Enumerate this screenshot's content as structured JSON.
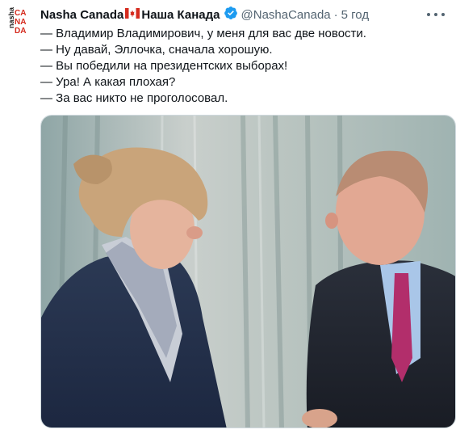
{
  "tweet": {
    "author": {
      "display_name": "Nasha Canada",
      "display_name_2": "Наша Канада",
      "handle": "@NashaCanada",
      "time": "5 год",
      "avatar_icon": "nasha-canada-logo",
      "flag_icon": "canada-flag-icon",
      "verified_icon": "verified-badge-icon"
    },
    "lines": [
      "— Владимир Владимирович, у меня для вас две новости.",
      "— Ну давай, Эллочка, сначала хорошую.",
      "— Вы победили на президентских выборах!",
      "— Ура! А какая плохая?",
      "— За вас никто не проголосовал."
    ],
    "separator": "·",
    "more_icon": "more-options-icon",
    "media": {
      "description_icon": "photo"
    },
    "colors": {
      "verified": "#1d9bf0",
      "secondary_text": "#536471",
      "flag_red": "#d52b1e"
    }
  }
}
